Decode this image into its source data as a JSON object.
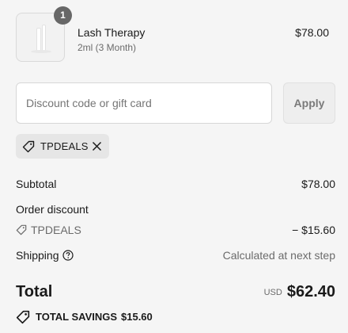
{
  "product": {
    "quantity": "1",
    "name": "Lash Therapy",
    "variant": "2ml (3 Month)",
    "price": "$78.00"
  },
  "discount": {
    "placeholder": "Discount code or gift card",
    "apply_label": "Apply",
    "applied_code": "TPDEALS"
  },
  "summary": {
    "subtotal_label": "Subtotal",
    "subtotal_value": "$78.00",
    "order_discount_label": "Order discount",
    "discount_code": "TPDEALS",
    "discount_value": "− $15.60",
    "shipping_label": "Shipping",
    "shipping_value": "Calculated at next step"
  },
  "total": {
    "label": "Total",
    "currency": "USD",
    "amount": "$62.40"
  },
  "savings": {
    "label": "TOTAL SAVINGS",
    "amount": "$15.60"
  },
  "icons": [
    "tag-icon",
    "close-icon",
    "help-circle-icon",
    "savings-tag-icon"
  ],
  "colors": {
    "background": "#f5f5f5",
    "badge": "#676767",
    "chip": "#e6e6e6"
  }
}
